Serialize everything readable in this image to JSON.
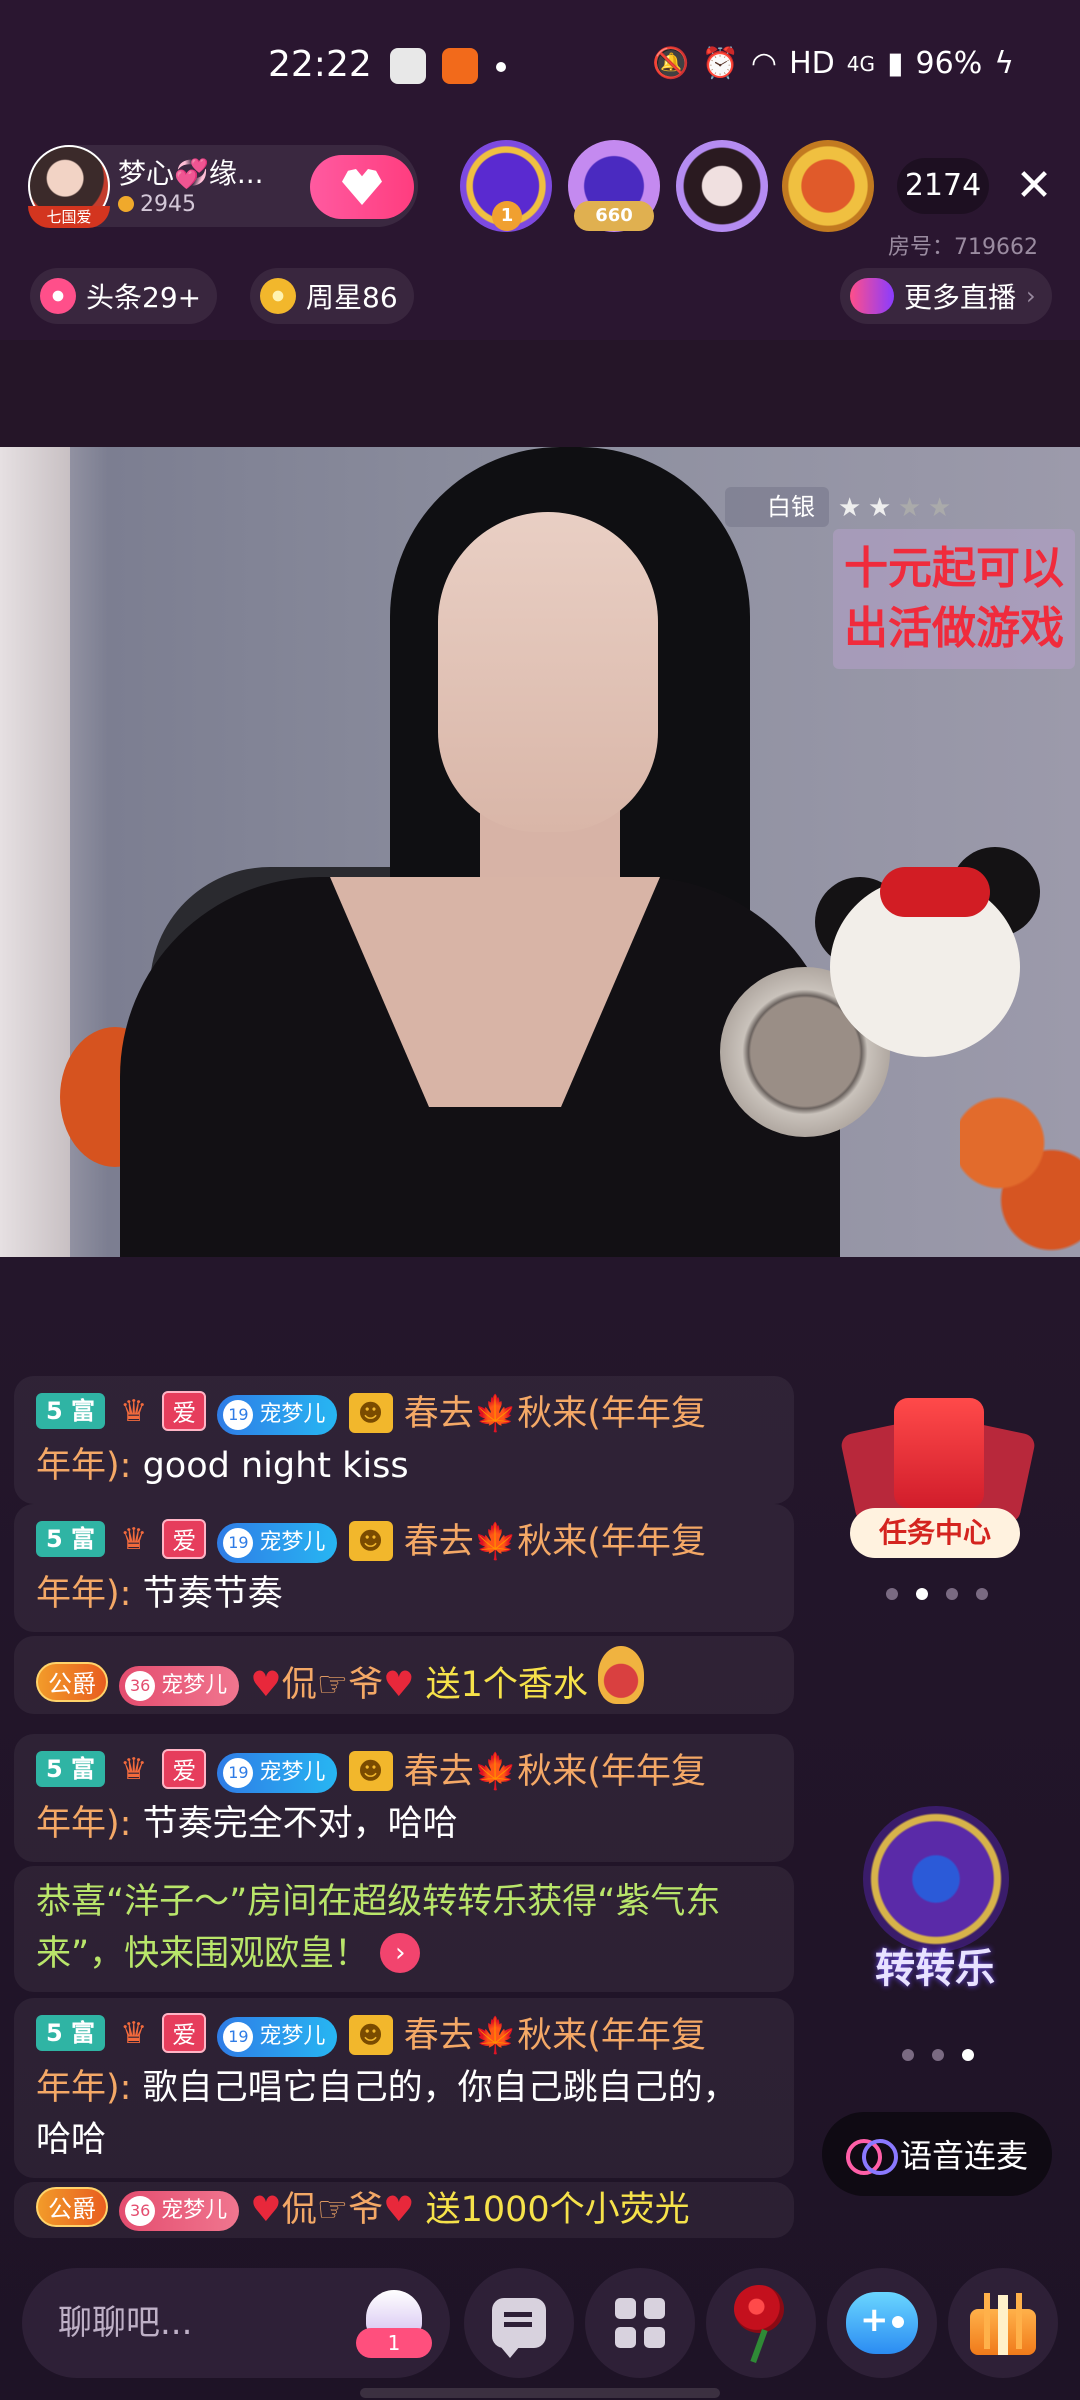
{
  "status_bar": {
    "time": "22:22",
    "network": "HD",
    "signal": "4G",
    "battery": "96%"
  },
  "host": {
    "name": "梦心💞缘...",
    "coins": "2945",
    "avatar_tag": "七国爱"
  },
  "top_viewers": [
    {
      "rank_label": "1",
      "color": "#7d4ae0"
    },
    {
      "rank_label": "660",
      "color": "#a36cf0"
    },
    {
      "rank_label": "",
      "color": "#b58cf2"
    },
    {
      "rank_label": "",
      "color": "#f0a030"
    }
  ],
  "viewer_count": "2174",
  "room_number": "房号：719662",
  "pills": {
    "headline": "头条29+",
    "weekly_star": "周星86",
    "more_live": "更多直播"
  },
  "video": {
    "rank_badge": "白银",
    "promo_text_line1": "十元起可以",
    "promo_text_line2": "出活做游戏"
  },
  "chat": {
    "messages": [
      {
        "line1_user": "春去🍁秋来(年年复",
        "line2_prefix": "年年):",
        "line2_text": " good night kiss"
      },
      {
        "line1_user": "春去🍁秋来(年年复",
        "line2_prefix": "年年):",
        "line2_text": " 节奏节奏"
      },
      {
        "noble": "公爵",
        "fan_lv": "36",
        "fan_name": "宠梦儿",
        "user": "侃☞爷",
        "gift": "送1个香水"
      },
      {
        "line1_user": "春去🍁秋来(年年复",
        "line2_prefix": "年年):",
        "line2_text": " 节奏完全不对，哈哈"
      },
      {
        "sys_line1": "恭喜“洋子～”房间在超级转转乐获得“紫气东",
        "sys_line2": "来”，快来围观欧皇！"
      },
      {
        "line1_user": "春去🍁秋来(年年复",
        "line2_prefix": "年年):",
        "line2_text": " 歌自己唱它自己的，你自己跳自己的，",
        "line3_text": "哈哈"
      },
      {
        "noble": "公爵",
        "fan_lv": "36",
        "fan_name": "宠梦儿",
        "user": "侃☞爷",
        "gift": "送1000个小荧光"
      }
    ],
    "badges": {
      "level": "5 富",
      "ai": "爱",
      "fan_lv": "19",
      "fan_name": "宠梦儿"
    }
  },
  "widgets": {
    "task_center": "任务中心",
    "spin": "转转乐",
    "voice_link": "语音连麦"
  },
  "bottom_bar": {
    "input_placeholder": "聊聊吧...",
    "fan_count": "1"
  }
}
